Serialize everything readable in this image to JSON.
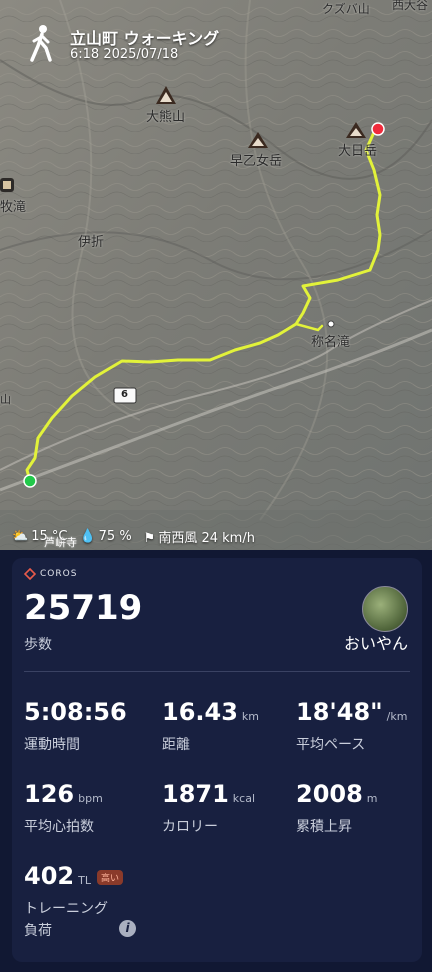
{
  "map": {
    "title": "立山町 ウォーキング",
    "subtitle": "6:18 2025/07/18",
    "places": [
      "クズバ山",
      "西大谷",
      "大熊山",
      "早乙女岳",
      "大日岳",
      "牧滝",
      "伊折",
      "称名滝",
      "山",
      "芦峅寺"
    ],
    "road_number": "6"
  },
  "weather": {
    "temperature": "15 °C",
    "humidity": "75 %",
    "wind": "南西風 24 km/h"
  },
  "card": {
    "brand": "COROS",
    "steps_value": "25719",
    "steps_label": "歩数",
    "user_name": "おいやん",
    "metrics": [
      {
        "value": "5:08:56",
        "unit": "",
        "label": "運動時間"
      },
      {
        "value": "16.43",
        "unit": "km",
        "label": "距離"
      },
      {
        "value": "18'48\"",
        "unit": "/km",
        "label": "平均ペース"
      },
      {
        "value": "126",
        "unit": "bpm",
        "label": "平均心拍数"
      },
      {
        "value": "1871",
        "unit": "kcal",
        "label": "カロリー"
      },
      {
        "value": "2008",
        "unit": "m",
        "label": "累積上昇"
      }
    ],
    "training_load": {
      "value": "402",
      "unit": "TL",
      "badge": "高い",
      "label_line1": "トレーニング",
      "label_line2": "負荷"
    }
  },
  "colors": {
    "route": "#e2f23a",
    "start": "#22c84a",
    "end": "#f02b3c",
    "card_bg": "#182040",
    "page_bg": "#111833"
  }
}
